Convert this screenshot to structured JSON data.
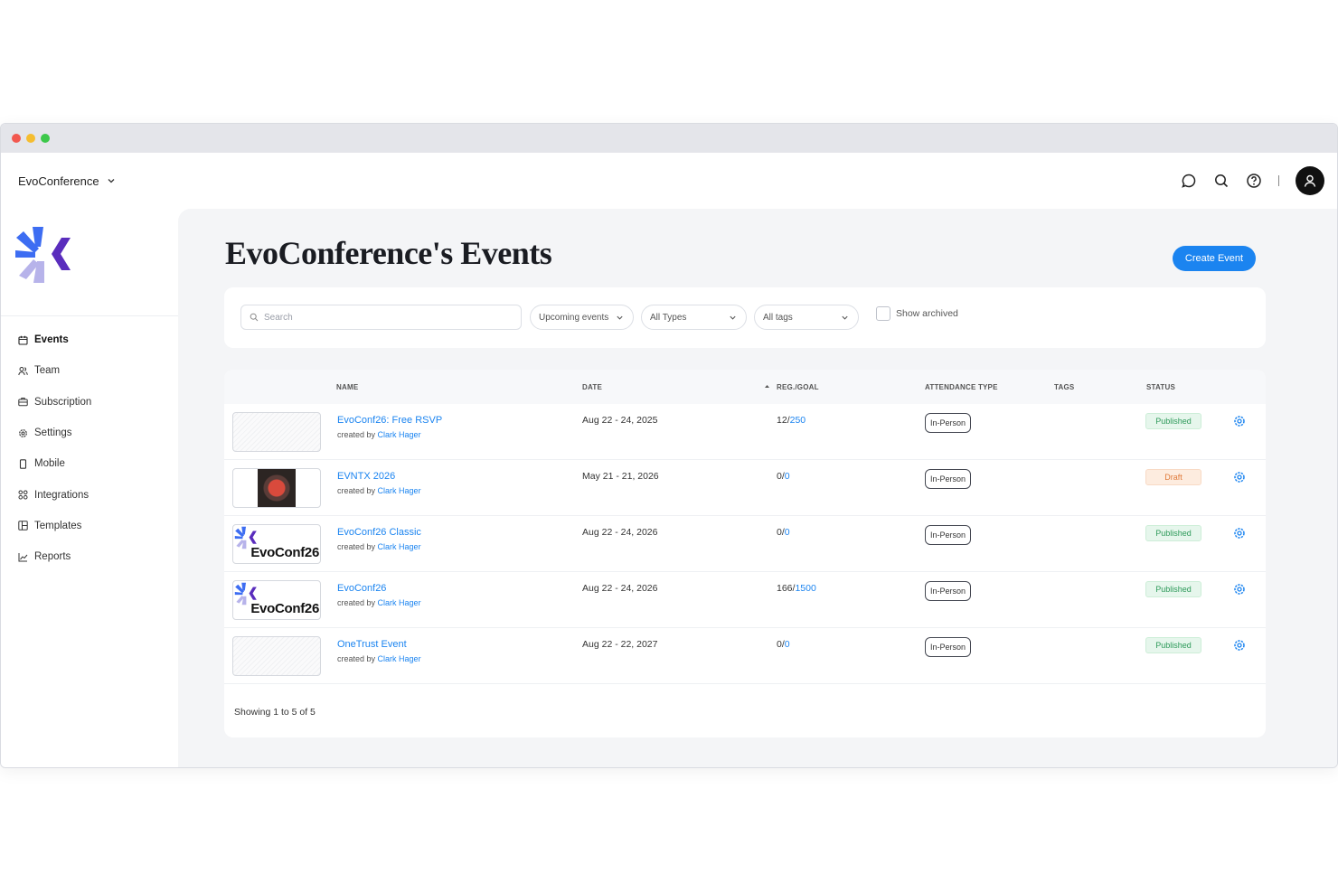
{
  "colors": {
    "accent": "#1b84f0",
    "published": "#2e9a5a",
    "draft": "#e07a3a",
    "logo_blue": "#3d6df2",
    "logo_purple": "#5a2dbd",
    "logo_light": "#b7b3ea"
  },
  "org": {
    "name": "EvoConference"
  },
  "topbar": {
    "icons": [
      "chat-icon",
      "search-icon",
      "help-icon",
      "user-icon"
    ]
  },
  "sidebar": {
    "items": [
      {
        "label": "Events",
        "icon": "calendar-icon",
        "active": true
      },
      {
        "label": "Team",
        "icon": "users-icon"
      },
      {
        "label": "Subscription",
        "icon": "briefcase-icon"
      },
      {
        "label": "Settings",
        "icon": "gear-icon"
      },
      {
        "label": "Mobile",
        "icon": "mobile-icon"
      },
      {
        "label": "Integrations",
        "icon": "grid-icon"
      },
      {
        "label": "Templates",
        "icon": "template-icon"
      },
      {
        "label": "Reports",
        "icon": "chart-icon"
      }
    ]
  },
  "main": {
    "title": "EvoConference's Events",
    "create_label": "Create Event"
  },
  "filters": {
    "search_placeholder": "Search",
    "when": "Upcoming events",
    "types": "All Types",
    "tags": "All tags",
    "show_archived": "Show archived"
  },
  "table": {
    "columns": {
      "name": "NAME",
      "date": "DATE",
      "reg": "REG./GOAL",
      "attendance": "ATTENDANCE TYPE",
      "tags": "TAGS",
      "status": "STATUS"
    },
    "created_by_prefix": "created by",
    "thumb_brand_text": "EvoConf26",
    "rows": [
      {
        "name": "EvoConf26: Free RSVP",
        "creator": "Clark Hager",
        "date": "Aug 22 - 24, 2025",
        "reg": "12",
        "goal": "250",
        "attendance": "In-Person",
        "status": "Published",
        "thumb": "hatch"
      },
      {
        "name": "EVNTX 2026",
        "creator": "Clark Hager",
        "date": "May 21 - 21, 2026",
        "reg": "0",
        "goal": "0",
        "attendance": "In-Person",
        "status": "Draft",
        "thumb": "photo"
      },
      {
        "name": "EvoConf26 Classic",
        "creator": "Clark Hager",
        "date": "Aug 22 - 24, 2026",
        "reg": "0",
        "goal": "0",
        "attendance": "In-Person",
        "status": "Published",
        "thumb": "brand"
      },
      {
        "name": "EvoConf26",
        "creator": "Clark Hager",
        "date": "Aug 22 - 24, 2026",
        "reg": "166",
        "goal": "1500",
        "attendance": "In-Person",
        "status": "Published",
        "thumb": "brand"
      },
      {
        "name": "OneTrust Event",
        "creator": "Clark Hager",
        "date": "Aug 22 - 22, 2027",
        "reg": "0",
        "goal": "0",
        "attendance": "In-Person",
        "status": "Published",
        "thumb": "hatch"
      }
    ],
    "footer": "Showing 1 to 5 of 5"
  }
}
